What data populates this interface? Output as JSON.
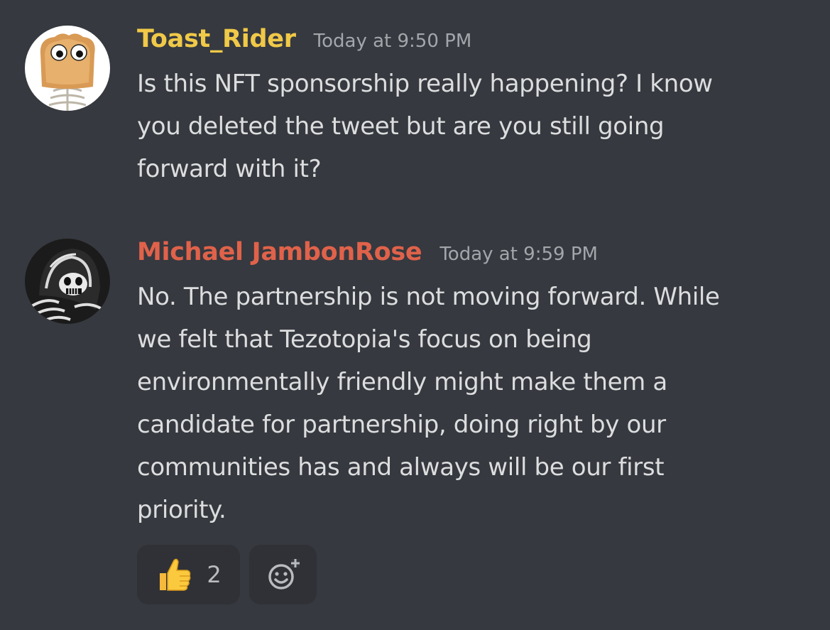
{
  "messages": [
    {
      "username": "Toast_Rider",
      "username_color": "#f0c948",
      "timestamp": "Today at 9:50 PM",
      "avatar": "toast-avatar-icon",
      "lines": [
        "Is this NFT sponsorship really happening? I know",
        "you deleted the tweet but are you still going",
        "forward with it?"
      ]
    },
    {
      "username": "Michael JambonRose",
      "username_color": "#e0624a",
      "timestamp": "Today at 9:59 PM",
      "avatar": "grim-reaper-avatar-icon",
      "lines": [
        "No. The partnership is not moving forward. While",
        "we felt that Tezotopia's focus on being",
        "environmentally friendly might make them a",
        "candidate for partnership, doing right by our",
        "communities has and always will be our first",
        "priority."
      ]
    }
  ],
  "reactions": [
    {
      "emoji": "thumbs-up-icon",
      "count": "2"
    }
  ],
  "add_reaction": {
    "icon": "add-reaction-icon"
  }
}
